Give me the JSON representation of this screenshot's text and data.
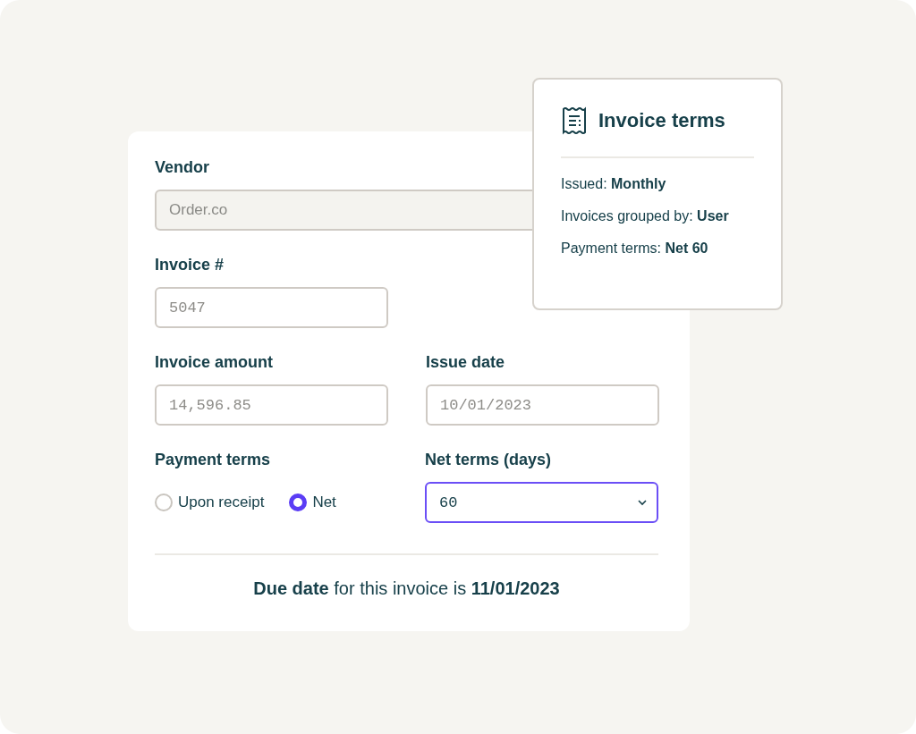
{
  "vendor": {
    "label": "Vendor",
    "value": "Order.co",
    "disabled": true
  },
  "invoice_number": {
    "label": "Invoice #",
    "placeholder": "5047"
  },
  "invoice_amount": {
    "label": "Invoice amount",
    "placeholder": "14,596.85"
  },
  "issue_date": {
    "label": "Issue date",
    "placeholder": "10/01/2023"
  },
  "payment_terms": {
    "label": "Payment terms",
    "options": [
      {
        "label": "Upon receipt",
        "selected": false
      },
      {
        "label": "Net",
        "selected": true
      }
    ]
  },
  "net_terms": {
    "label": "Net terms (days)",
    "value": "60",
    "focused": true
  },
  "due_date": "**Due date** for this invoice is **11/01/2023**",
  "popover": {
    "title": "Invoice terms",
    "lines": [
      "Issued: **Monthly**",
      "Invoices grouped by: **User**",
      "Payment terms: **Net 60**"
    ]
  }
}
